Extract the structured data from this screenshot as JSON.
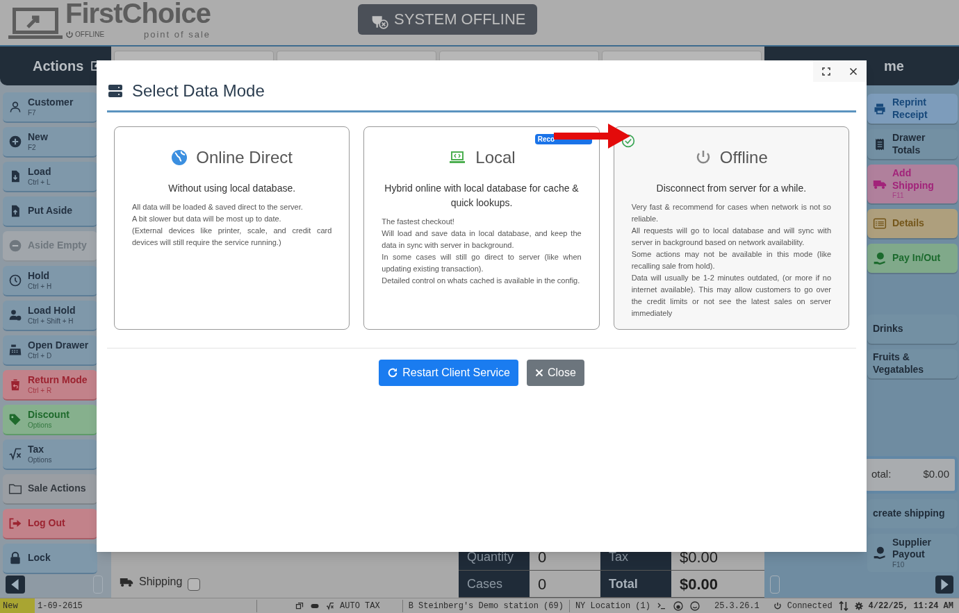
{
  "header": {
    "brand": "FirstChoice",
    "tagline": "point of sale",
    "mode": "OFFLINE",
    "status_button": "SYSTEM OFFLINE"
  },
  "actions_panel": {
    "title": "Actions",
    "items": [
      {
        "label": "Customer",
        "shortcut": "F7",
        "kind": "default"
      },
      {
        "label": "New",
        "shortcut": "F2",
        "kind": "default"
      },
      {
        "label": "Load",
        "shortcut": "Ctrl + L",
        "kind": "default"
      },
      {
        "label": "Put Aside",
        "kind": "default"
      },
      {
        "label": "Aside Empty",
        "kind": "disabled"
      },
      {
        "label": "Hold",
        "shortcut": "Ctrl + H",
        "kind": "default"
      },
      {
        "label": "Load Hold",
        "shortcut": "Ctrl + Shift + H",
        "kind": "default"
      },
      {
        "label": "Open Drawer",
        "shortcut": "Ctrl + D",
        "kind": "default"
      },
      {
        "label": "Return Mode",
        "shortcut": "Ctrl + R",
        "kind": "danger"
      },
      {
        "label": "Discount",
        "shortcut": "Options",
        "kind": "success"
      },
      {
        "label": "Tax",
        "shortcut": "Options",
        "kind": "default"
      },
      {
        "label": "Sale Actions",
        "kind": "neutral"
      },
      {
        "label": "Log Out",
        "kind": "danger"
      },
      {
        "label": "Lock",
        "kind": "default"
      }
    ]
  },
  "home_panel": {
    "title": "me",
    "items": [
      {
        "label": "Reprint Receipt",
        "kind": "primary"
      },
      {
        "label": "Drawer Totals",
        "kind": "default"
      },
      {
        "label": "Add Shipping",
        "shortcut": "F11",
        "kind": "pink"
      },
      {
        "label": "Details",
        "kind": "warning"
      },
      {
        "label": "Pay In/Out",
        "kind": "success"
      }
    ],
    "categories": [
      "Drinks",
      "Fruits & Vegatables"
    ],
    "total_label": "otal:",
    "total_value": "$0.00",
    "bottom_items": [
      {
        "label": "create shipping"
      },
      {
        "label": "Supplier Payout",
        "shortcut": "F10"
      }
    ]
  },
  "shipping": {
    "label": "Shipping",
    "checked": false
  },
  "totals": [
    {
      "label": "Quantity",
      "value": "0"
    },
    {
      "label": "Tax",
      "value": "$0.00"
    },
    {
      "label": "Cases",
      "value": "0"
    },
    {
      "label": "Total",
      "value": "$0.00"
    }
  ],
  "status_bar": {
    "mode": "New",
    "receipt": "1-69-2615",
    "tax": "AUTO TAX",
    "station": "B Steinberg's Demo station (69)",
    "location": "NY Location (1)",
    "version": "25.3.26.1",
    "connection": "Connected",
    "datetime": "4/22/25, 11:24 AM"
  },
  "dialog": {
    "title": "Select Data Mode",
    "options": [
      {
        "title": "Online Direct",
        "subtitle": "Without using local database.",
        "selected": false,
        "lines": [
          "All data will be loaded & saved direct to the server.",
          "A bit slower but data will be most up to date.",
          "(External devices like printer, scale, and credit card devices will still require the service running.)"
        ]
      },
      {
        "title": "Local",
        "subtitle": "Hybrid online with local database for cache & quick lookups.",
        "badge": "Reco",
        "selected": false,
        "lines": [
          "The fastest checkout!",
          "Will load and save data in local database, and keep the data in sync with server in background.",
          "In some cases will still go direct to server (like when updating existing transaction).",
          "Detailed control on whats cached is available in the config."
        ]
      },
      {
        "title": "Offline",
        "subtitle": "Disconnect from server for a while.",
        "selected": true,
        "lines": [
          "Very fast & recommend for cases when network is not so reliable.",
          "All requests will go to local database and will sync with server in background based on network availability.",
          "Some actions may not be available in this mode (like recalling sale from hold).",
          "Data will usually be 1-2 minutes outdated, (or more if no internet available). This may allow customers to go over the credit limits or not see the latest sales on server immediately"
        ]
      }
    ],
    "buttons": [
      {
        "label": "Restart Client Service",
        "kind": "primary"
      },
      {
        "label": "Close",
        "kind": "secondary"
      }
    ]
  }
}
